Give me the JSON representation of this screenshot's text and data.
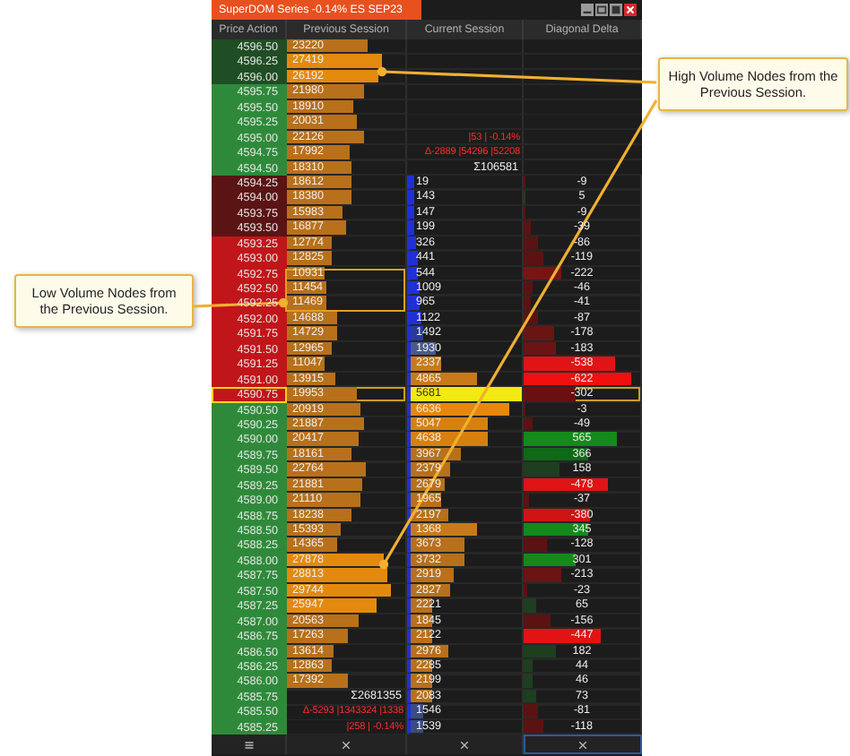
{
  "window": {
    "title": "SuperDOM Series -0.14% ES SEP23"
  },
  "columns": [
    "Price Action",
    "Previous Session",
    "Current Session",
    "Diagonal Delta"
  ],
  "callouts": [
    {
      "text": "Low Volume Nodes from the Previous Session."
    },
    {
      "text": "High Volume Nodes from the Previous Session."
    }
  ],
  "rows": [
    {
      "price": {
        "text": "4596.50",
        "color": "#1f4d24"
      },
      "previous": {
        "kind": "volume",
        "text": "23220",
        "level": 0.68
      },
      "selected": false
    },
    {
      "price": {
        "text": "4596.25",
        "color": "#1f4d24"
      },
      "previous": {
        "kind": "volume",
        "text": "27419",
        "level": 0.81
      },
      "selected": false
    },
    {
      "price": {
        "text": "4596.00",
        "color": "#1f4d24"
      },
      "previous": {
        "kind": "volume",
        "text": "26192",
        "level": 0.77
      },
      "selected": false
    },
    {
      "price": {
        "text": "4595.75",
        "color": "#2e8a3a"
      },
      "previous": {
        "kind": "volume",
        "text": "21980",
        "level": 0.65
      },
      "selected": false
    },
    {
      "price": {
        "text": "4595.50",
        "color": "#2e8a3a"
      },
      "previous": {
        "kind": "volume",
        "text": "18910",
        "level": 0.56
      },
      "selected": false
    },
    {
      "price": {
        "text": "4595.25",
        "color": "#2e8a3a"
      },
      "previous": {
        "kind": "volume",
        "text": "20031",
        "level": 0.59
      },
      "selected": false
    },
    {
      "price": {
        "text": "4595.00",
        "color": "#2e8a3a"
      },
      "previous": {
        "kind": "volume",
        "text": "22126",
        "level": 0.65
      },
      "current": {
        "kind": "stats",
        "text": "|53 | -0.14%"
      },
      "selected": false
    },
    {
      "price": {
        "text": "4594.75",
        "color": "#2e8a3a"
      },
      "previous": {
        "kind": "volume",
        "text": "17992",
        "level": 0.53
      },
      "current": {
        "kind": "stats",
        "text": "Δ-2889 |54296 |52208"
      },
      "selected": false
    },
    {
      "price": {
        "text": "4594.50",
        "color": "#2e8a3a"
      },
      "previous": {
        "kind": "volume",
        "text": "18310",
        "level": 0.54
      },
      "current": {
        "kind": "total",
        "text": "Σ106581"
      },
      "selected": false
    },
    {
      "price": {
        "text": "4594.25",
        "color": "#5a1414"
      },
      "previous": {
        "kind": "volume",
        "text": "18612",
        "level": 0.55
      },
      "current": {
        "kind": "volume",
        "text": "19",
        "level": 0.03,
        "color": "#2030d8"
      },
      "delta": {
        "text": "-9",
        "level": 0.01,
        "color": "#5c1212"
      },
      "selected": false
    },
    {
      "price": {
        "text": "4594.00",
        "color": "#5a1414"
      },
      "previous": {
        "kind": "volume",
        "text": "18380",
        "level": 0.54
      },
      "current": {
        "kind": "volume",
        "text": "143",
        "level": 0.04,
        "color": "#2030d8"
      },
      "delta": {
        "text": "5",
        "level": 0.01,
        "color": "#1d3f1f"
      },
      "selected": false
    },
    {
      "price": {
        "text": "4593.75",
        "color": "#5a1414"
      },
      "previous": {
        "kind": "volume",
        "text": "15983",
        "level": 0.47
      },
      "current": {
        "kind": "volume",
        "text": "147",
        "level": 0.04,
        "color": "#2030d8"
      },
      "delta": {
        "text": "-9",
        "level": 0.01,
        "color": "#5c1212"
      },
      "selected": false
    },
    {
      "price": {
        "text": "4593.50",
        "color": "#5a1414"
      },
      "previous": {
        "kind": "volume",
        "text": "16877",
        "level": 0.5
      },
      "current": {
        "kind": "volume",
        "text": "199",
        "level": 0.04,
        "color": "#2030d8"
      },
      "delta": {
        "text": "-39",
        "level": 0.06,
        "color": "#5c1212"
      },
      "selected": false
    },
    {
      "price": {
        "text": "4593.25",
        "color": "#c0161a"
      },
      "previous": {
        "kind": "volume",
        "text": "12774",
        "level": 0.38
      },
      "current": {
        "kind": "volume",
        "text": "326",
        "level": 0.05,
        "color": "#2030d8"
      },
      "delta": {
        "text": "-86",
        "level": 0.12,
        "color": "#5c1212"
      },
      "selected": false
    },
    {
      "price": {
        "text": "4593.00",
        "color": "#c0161a"
      },
      "previous": {
        "kind": "volume",
        "text": "12825",
        "level": 0.38
      },
      "current": {
        "kind": "volume",
        "text": "441",
        "level": 0.06,
        "color": "#2030d8"
      },
      "delta": {
        "text": "-119",
        "level": 0.17,
        "color": "#5c1212"
      },
      "selected": false
    },
    {
      "price": {
        "text": "4592.75",
        "color": "#c0161a"
      },
      "previous": {
        "kind": "volume",
        "text": "10931",
        "level": 0.32
      },
      "current": {
        "kind": "volume",
        "text": "544",
        "level": 0.07,
        "color": "#2030d8"
      },
      "delta": {
        "text": "-222",
        "level": 0.32,
        "color": "#7a1414"
      },
      "selected": false
    },
    {
      "price": {
        "text": "4592.50",
        "color": "#c0161a"
      },
      "previous": {
        "kind": "volume",
        "text": "11454",
        "level": 0.34
      },
      "current": {
        "kind": "volume",
        "text": "1009",
        "level": 0.08,
        "color": "#2030d8"
      },
      "delta": {
        "text": "-46",
        "level": 0.07,
        "color": "#5c1212"
      },
      "selected": false
    },
    {
      "price": {
        "text": "4592.25",
        "color": "#c0161a"
      },
      "previous": {
        "kind": "volume",
        "text": "11469",
        "level": 0.34
      },
      "current": {
        "kind": "volume",
        "text": "965",
        "level": 0.08,
        "color": "#2030d8"
      },
      "delta": {
        "text": "-41",
        "level": 0.06,
        "color": "#5c1212"
      },
      "selected": false
    },
    {
      "price": {
        "text": "4592.00",
        "color": "#c0161a"
      },
      "previous": {
        "kind": "volume",
        "text": "14688",
        "level": 0.43
      },
      "current": {
        "kind": "volume",
        "text": "1122",
        "level": 0.09,
        "color": "#2030d8"
      },
      "delta": {
        "text": "-87",
        "level": 0.13,
        "color": "#5c1212"
      },
      "selected": false
    },
    {
      "price": {
        "text": "4591.75",
        "color": "#c0161a"
      },
      "previous": {
        "kind": "volume",
        "text": "14729",
        "level": 0.43
      },
      "current": {
        "kind": "volume",
        "text": "1492",
        "level": 0.12,
        "color": "#2a3a9a"
      },
      "delta": {
        "text": "-178",
        "level": 0.26,
        "color": "#6a1414"
      },
      "selected": false
    },
    {
      "price": {
        "text": "4591.50",
        "color": "#c0161a"
      },
      "previous": {
        "kind": "volume",
        "text": "12965",
        "level": 0.38
      },
      "current": {
        "kind": "volume",
        "text": "1930",
        "level": 0.22,
        "color": "#4a5a8a"
      },
      "delta": {
        "text": "-183",
        "level": 0.27,
        "color": "#6a1414"
      },
      "selected": false
    },
    {
      "price": {
        "text": "4591.25",
        "color": "#c0161a"
      },
      "previous": {
        "kind": "volume",
        "text": "11047",
        "level": 0.32
      },
      "current": {
        "kind": "volume",
        "text": "2337",
        "level": 0.27,
        "color": "#c87a1a"
      },
      "delta": {
        "text": "-538",
        "level": 0.78,
        "color": "#e01414"
      },
      "selected": false
    },
    {
      "price": {
        "text": "4591.00",
        "color": "#c0161a"
      },
      "previous": {
        "kind": "volume",
        "text": "13915",
        "level": 0.41
      },
      "current": {
        "kind": "volume",
        "text": "4865",
        "level": 0.6,
        "color": "#c87a1a"
      },
      "delta": {
        "text": "-622",
        "level": 0.92,
        "color": "#f01010"
      },
      "selected": false
    },
    {
      "price": {
        "text": "4590.75",
        "color": "#c0161a"
      },
      "previous": {
        "kind": "volume",
        "text": "19953",
        "level": 0.59
      },
      "current": {
        "kind": "volume",
        "text": "5681",
        "level": 1,
        "color": "#f2ea10"
      },
      "delta": {
        "text": "-302",
        "level": 0.44,
        "color": "#6a1010"
      },
      "selected": true
    },
    {
      "price": {
        "text": "4590.50",
        "color": "#2e8a3a"
      },
      "previous": {
        "kind": "volume",
        "text": "20919",
        "level": 0.62
      },
      "current": {
        "kind": "volume",
        "text": "6636",
        "level": 0.88,
        "color": "#e8870e"
      },
      "delta": {
        "text": "-3",
        "level": 0.01,
        "color": "#5c1212"
      },
      "selected": false
    },
    {
      "price": {
        "text": "4590.25",
        "color": "#2e8a3a"
      },
      "previous": {
        "kind": "volume",
        "text": "21887",
        "level": 0.65
      },
      "current": {
        "kind": "volume",
        "text": "5047",
        "level": 0.7,
        "color": "#d8800e"
      },
      "delta": {
        "text": "-49",
        "level": 0.07,
        "color": "#5c1212"
      },
      "selected": false
    },
    {
      "price": {
        "text": "4590.00",
        "color": "#2e8a3a"
      },
      "previous": {
        "kind": "volume",
        "text": "20417",
        "level": 0.6
      },
      "current": {
        "kind": "volume",
        "text": "4638",
        "level": 0.7,
        "color": "#d8800e"
      },
      "delta": {
        "text": "565",
        "level": 0.8,
        "color": "#138a1a"
      },
      "selected": false
    },
    {
      "price": {
        "text": "4589.75",
        "color": "#2e8a3a"
      },
      "previous": {
        "kind": "volume",
        "text": "18161",
        "level": 0.54
      },
      "current": {
        "kind": "volume",
        "text": "3967",
        "level": 0.45,
        "color": "#b8701a"
      },
      "delta": {
        "text": "366",
        "level": 0.55,
        "color": "#0e6a16"
      },
      "selected": false
    },
    {
      "price": {
        "text": "4589.50",
        "color": "#2e8a3a"
      },
      "previous": {
        "kind": "volume",
        "text": "22764",
        "level": 0.67
      },
      "current": {
        "kind": "volume",
        "text": "2379",
        "level": 0.35,
        "color": "#b8701a"
      },
      "delta": {
        "text": "158",
        "level": 0.3,
        "color": "#1d3f1f"
      },
      "selected": false
    },
    {
      "price": {
        "text": "4589.25",
        "color": "#2e8a3a"
      },
      "previous": {
        "kind": "volume",
        "text": "21881",
        "level": 0.64
      },
      "current": {
        "kind": "volume",
        "text": "2679",
        "level": 0.3,
        "color": "#b8701a"
      },
      "delta": {
        "text": "-478",
        "level": 0.72,
        "color": "#e01414"
      },
      "selected": false
    },
    {
      "price": {
        "text": "4589.00",
        "color": "#2e8a3a"
      },
      "previous": {
        "kind": "volume",
        "text": "21110",
        "level": 0.62
      },
      "current": {
        "kind": "volume",
        "text": "1965",
        "level": 0.27,
        "color": "#b8701a"
      },
      "delta": {
        "text": "-37",
        "level": 0.05,
        "color": "#5c1212"
      },
      "selected": false
    },
    {
      "price": {
        "text": "4588.75",
        "color": "#2e8a3a"
      },
      "previous": {
        "kind": "volume",
        "text": "18238",
        "level": 0.54
      },
      "current": {
        "kind": "volume",
        "text": "2197",
        "level": 0.34,
        "color": "#b8701a"
      },
      "delta": {
        "text": "-380",
        "level": 0.57,
        "color": "#d01414"
      },
      "selected": false
    },
    {
      "price": {
        "text": "4588.50",
        "color": "#2e8a3a"
      },
      "previous": {
        "kind": "volume",
        "text": "15393",
        "level": 0.45
      },
      "current": {
        "kind": "volume",
        "text": "1368",
        "level": 0.6,
        "color": "#c87a1a"
      },
      "delta": {
        "text": "345",
        "level": 0.55,
        "color": "#138a1a"
      },
      "selected": false
    },
    {
      "price": {
        "text": "4588.25",
        "color": "#2e8a3a"
      },
      "previous": {
        "kind": "volume",
        "text": "14365",
        "level": 0.42
      },
      "current": {
        "kind": "volume",
        "text": "3673",
        "level": 0.48,
        "color": "#b8701a"
      },
      "delta": {
        "text": "-128",
        "level": 0.2,
        "color": "#5c1212"
      },
      "selected": false
    },
    {
      "price": {
        "text": "4588.00",
        "color": "#2e8a3a"
      },
      "previous": {
        "kind": "volume",
        "text": "27878",
        "level": 0.82
      },
      "current": {
        "kind": "volume",
        "text": "3732",
        "level": 0.48,
        "color": "#b8701a"
      },
      "delta": {
        "text": "301",
        "level": 0.45,
        "color": "#138a1a"
      },
      "selected": false
    },
    {
      "price": {
        "text": "4587.75",
        "color": "#2e8a3a"
      },
      "previous": {
        "kind": "volume",
        "text": "28813",
        "level": 0.85
      },
      "current": {
        "kind": "volume",
        "text": "2919",
        "level": 0.38,
        "color": "#b8701a"
      },
      "delta": {
        "text": "-213",
        "level": 0.32,
        "color": "#6a1414"
      },
      "selected": false
    },
    {
      "price": {
        "text": "4587.50",
        "color": "#2e8a3a"
      },
      "previous": {
        "kind": "volume",
        "text": "29744",
        "level": 0.88
      },
      "current": {
        "kind": "volume",
        "text": "2827",
        "level": 0.36,
        "color": "#b8701a"
      },
      "delta": {
        "text": "-23",
        "level": 0.03,
        "color": "#5c1212"
      },
      "selected": false
    },
    {
      "price": {
        "text": "4587.25",
        "color": "#2e8a3a"
      },
      "previous": {
        "kind": "volume",
        "text": "25947",
        "level": 0.76
      },
      "current": {
        "kind": "volume",
        "text": "2221",
        "level": 0.2,
        "color": "#b8701a"
      },
      "delta": {
        "text": "65",
        "level": 0.1,
        "color": "#1d3f1f"
      },
      "selected": false
    },
    {
      "price": {
        "text": "4587.00",
        "color": "#2e8a3a"
      },
      "previous": {
        "kind": "volume",
        "text": "20563",
        "level": 0.6
      },
      "current": {
        "kind": "volume",
        "text": "1845",
        "level": 0.2,
        "color": "#b8701a"
      },
      "delta": {
        "text": "-156",
        "level": 0.23,
        "color": "#5c1212"
      },
      "selected": false
    },
    {
      "price": {
        "text": "4586.75",
        "color": "#2e8a3a"
      },
      "previous": {
        "kind": "volume",
        "text": "17263",
        "level": 0.51
      },
      "current": {
        "kind": "volume",
        "text": "2122",
        "level": 0.2,
        "color": "#b8701a"
      },
      "delta": {
        "text": "-447",
        "level": 0.66,
        "color": "#e01414"
      },
      "selected": false
    },
    {
      "price": {
        "text": "4586.50",
        "color": "#2e8a3a"
      },
      "previous": {
        "kind": "volume",
        "text": "13614",
        "level": 0.4
      },
      "current": {
        "kind": "volume",
        "text": "2976",
        "level": 0.34,
        "color": "#b8701a"
      },
      "delta": {
        "text": "182",
        "level": 0.27,
        "color": "#1d3f1f"
      },
      "selected": false
    },
    {
      "price": {
        "text": "4586.25",
        "color": "#2e8a3a"
      },
      "previous": {
        "kind": "volume",
        "text": "12863",
        "level": 0.38
      },
      "current": {
        "kind": "volume",
        "text": "2285",
        "level": 0.2,
        "color": "#b8701a"
      },
      "delta": {
        "text": "44",
        "level": 0.07,
        "color": "#1d3f1f"
      },
      "selected": false
    },
    {
      "price": {
        "text": "4586.00",
        "color": "#2e8a3a"
      },
      "previous": {
        "kind": "volume",
        "text": "17392",
        "level": 0.51
      },
      "current": {
        "kind": "volume",
        "text": "2199",
        "level": 0.2,
        "color": "#b8701a"
      },
      "delta": {
        "text": "46",
        "level": 0.07,
        "color": "#1d3f1f"
      },
      "selected": false
    },
    {
      "price": {
        "text": "4585.75",
        "color": "#2e8a3a"
      },
      "previous": {
        "kind": "total",
        "text": "Σ2681355"
      },
      "current": {
        "kind": "volume",
        "text": "2083",
        "level": 0.19,
        "color": "#b8701a"
      },
      "delta": {
        "text": "73",
        "level": 0.1,
        "color": "#1d3f1f"
      },
      "selected": false
    },
    {
      "price": {
        "text": "4585.50",
        "color": "#2e8a3a"
      },
      "previous": {
        "kind": "stats",
        "text": "Δ-5293 |1343324 |1338"
      },
      "current": {
        "kind": "volume",
        "text": "1546",
        "level": 0.12,
        "color": "#3a4c80"
      },
      "delta": {
        "text": "-81",
        "level": 0.12,
        "color": "#5c1212"
      },
      "selected": false
    },
    {
      "price": {
        "text": "4585.25",
        "color": "#2e8a3a"
      },
      "previous": {
        "kind": "stats",
        "text": "|258 | -0.14%"
      },
      "current": {
        "kind": "volume",
        "text": "1539",
        "level": 0.12,
        "color": "#3a4c80"
      },
      "delta": {
        "text": "-118",
        "level": 0.17,
        "color": "#5c1212"
      },
      "selected": false
    }
  ]
}
